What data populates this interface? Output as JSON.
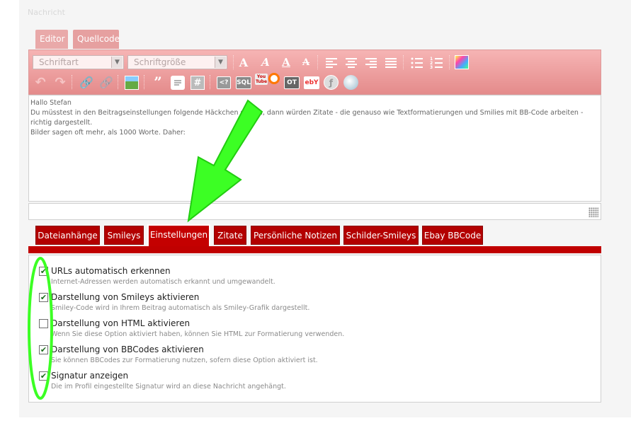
{
  "section_label": "Nachricht",
  "mode_tabs": {
    "editor": "Editor",
    "source": "Quellcode"
  },
  "toolbar": {
    "font_select": "Schriftart",
    "size_select": "Schriftgröße",
    "quote_glyph": "”",
    "code_glyph": "#",
    "php_label": "<?",
    "sql_label": "SQL",
    "youtube_label": "You Tube",
    "ot_label": "OT",
    "ebay_label": "ebY"
  },
  "message": {
    "lines": [
      "Hallo Stefan",
      "",
      "Du müsstest in den Beitragseinstellungen folgende Häckchen setzen, dann würden Zitate - die genauso wie Textformatierungen und Smilies mit BB-Code arbeiten -",
      "richtig dargestellt.",
      "",
      "Bilder sagen oft mehr, als 1000 Worte. Daher:"
    ]
  },
  "option_tabs": [
    "Dateianhänge",
    "Smileys",
    "Einstellungen",
    "Zitate",
    "Persönliche Notizen",
    "Schilder-Smileys",
    "Ebay BBCode"
  ],
  "active_tab_index": 2,
  "options": [
    {
      "checked": true,
      "label": "URLs automatisch erkennen",
      "desc": "Internet-Adressen werden automatisch erkannt und umgewandelt."
    },
    {
      "checked": true,
      "label": "Darstellung von Smileys aktivieren",
      "desc": "Smiley-Code wird in Ihrem Beitrag automatisch als Smiley-Grafik dargestellt."
    },
    {
      "checked": false,
      "label": "Darstellung von HTML aktivieren",
      "desc": "Wenn Sie diese Option aktiviert haben, können Sie HTML zur Formatierung verwenden."
    },
    {
      "checked": true,
      "label": "Darstellung von BBCodes aktivieren",
      "desc": "Sie können BBCodes zur Formatierung nutzen, sofern diese Option aktiviert ist."
    },
    {
      "checked": true,
      "label": "Signatur anzeigen",
      "desc": "Die im Profil eingestellte Signatur wird an diese Nachricht angehängt."
    }
  ],
  "colors": {
    "tab_red": "#b30000",
    "annotation_green": "#33ff22",
    "toolbar_pink": "#e48b8b"
  }
}
